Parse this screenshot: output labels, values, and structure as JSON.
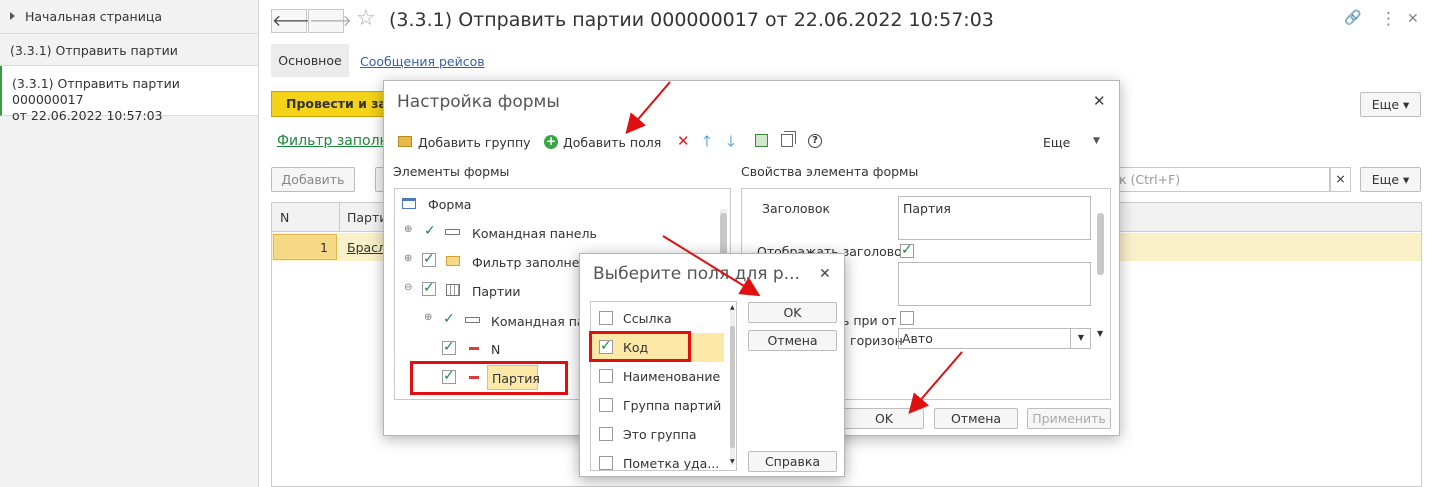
{
  "sidebar": {
    "home": "Начальная страница",
    "item1": "(3.3.1) Отправить партии",
    "item2_line1": "(3.3.1) Отправить партии 000000017",
    "item2_line2": "от 22.06.2022 10:57:03"
  },
  "header": {
    "back": "🡐",
    "forward": "🡒",
    "title": "(3.3.1) Отправить партии 000000017 от 22.06.2022 10:57:03",
    "link_icon": "🔗",
    "menu_icon": "⋮",
    "close_icon": "✕"
  },
  "tabs": {
    "main": "Основное",
    "messages": "Сообщения рейсов"
  },
  "toolbar": {
    "post_close": "Провести и зак",
    "more": "Еще ▾",
    "filter": "Фильтр заполне",
    "add": "Добавить",
    "search_ph": "к (Ctrl+F)",
    "clear": "×",
    "more2": "Еще ▾"
  },
  "grid": {
    "col_n": "N",
    "col_party": "Парти",
    "row_n": "1",
    "row_party": "Брасл"
  },
  "dialog1": {
    "title": "Настройка формы",
    "add_group": "Добавить группу",
    "add_fields": "Добавить поля",
    "more": "Еще",
    "left_header": "Элементы формы",
    "right_header": "Свойства элемента формы",
    "tree": [
      "Форма",
      "Командная панель",
      "Фильтр заполнени",
      "Партии",
      "Командная пане",
      "N",
      "Партия"
    ],
    "props": {
      "caption_label": "Заголовок",
      "caption_value": "Партия",
      "show_caption": "Отображать заголовок",
      "at_label": "ь при от",
      "horiz_label": "горизон",
      "horiz_value": "Авто"
    },
    "ok": "OK",
    "cancel": "Отмена",
    "apply": "Применить"
  },
  "dialog2": {
    "title": "Выберите поля для р...",
    "fields": [
      {
        "label": "Ссылка",
        "checked": false
      },
      {
        "label": "Код",
        "checked": true
      },
      {
        "label": "Наименование",
        "checked": false
      },
      {
        "label": "Группа партий",
        "checked": false
      },
      {
        "label": "Это группа",
        "checked": false
      },
      {
        "label": "Пометка уда...",
        "checked": false
      }
    ],
    "ok": "OK",
    "cancel": "Отмена",
    "help": "Справка"
  }
}
